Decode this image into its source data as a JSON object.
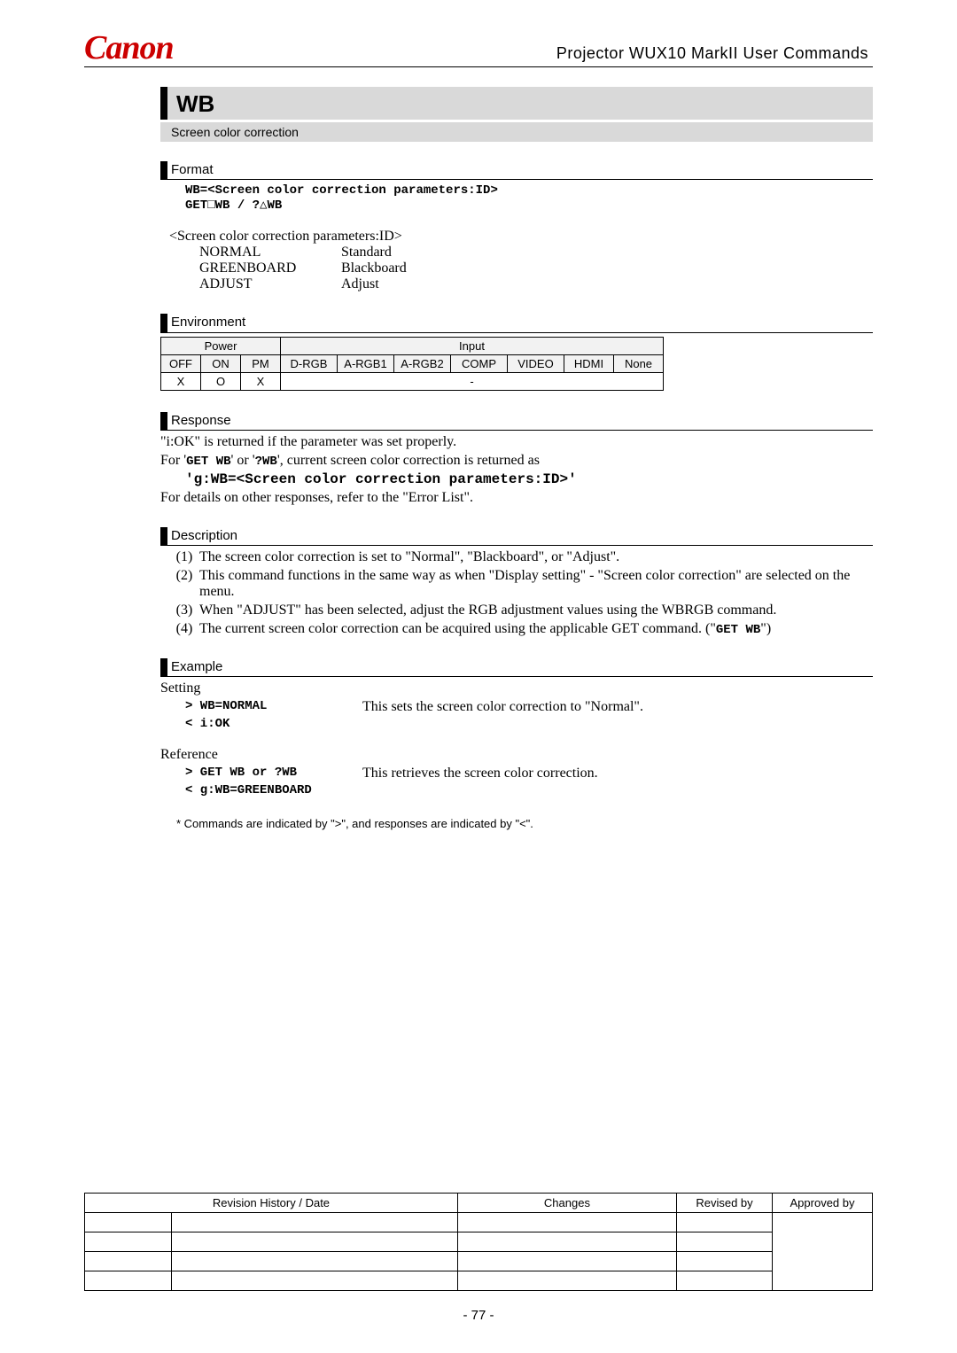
{
  "header": {
    "logo": "Canon",
    "doc_title": "Projector WUX10 MarkII User Commands"
  },
  "command": {
    "name": "WB",
    "subtitle": "Screen color correction"
  },
  "format": {
    "heading": "Format",
    "line1": "WB=<Screen color correction parameters:ID>",
    "line2_pre": "GET",
    "line2_mid": "WB   /   ?",
    "line2_post": "WB",
    "param_heading": "<Screen color correction parameters:ID>",
    "params": [
      {
        "id": "NORMAL",
        "desc": "Standard"
      },
      {
        "id": "GREENBOARD",
        "desc": "Blackboard"
      },
      {
        "id": "ADJUST",
        "desc": "Adjust"
      }
    ]
  },
  "environment": {
    "heading": "Environment",
    "power_label": "Power",
    "input_label": "Input",
    "power_cols": [
      "OFF",
      "ON",
      "PM"
    ],
    "input_cols": [
      "D-RGB",
      "A-RGB1",
      "A-RGB2",
      "COMP",
      "VIDEO",
      "HDMI",
      "None"
    ],
    "power_vals": [
      "X",
      "O",
      "X"
    ],
    "input_val": "-"
  },
  "response": {
    "heading": "Response",
    "line1": "\"i:OK\" is returned if the parameter was set properly.",
    "line2_pre": "For '",
    "line2_cmd1": "GET WB",
    "line2_mid": "' or '",
    "line2_cmd2": "?WB",
    "line2_post": "', current screen color correction is returned as",
    "line3": "'g:WB=<Screen color correction parameters:ID>'",
    "line4": "For details on other responses, refer to the \"Error List\"."
  },
  "description": {
    "heading": "Description",
    "items": [
      {
        "n": "(1)",
        "t": "The screen color correction is set to \"Normal\", \"Blackboard\", or \"Adjust\"."
      },
      {
        "n": "(2)",
        "t": "This command functions in the same way as when \"Display setting\" - \"Screen color correction\" are selected on the menu."
      },
      {
        "n": "(3)",
        "t": "When \"ADJUST\" has been selected, adjust the RGB adjustment values using the WBRGB command."
      }
    ],
    "item4_n": "(4)",
    "item4_pre": "The current screen color correction can be acquired using the applicable GET command. (\"",
    "item4_cmd": "GET WB",
    "item4_post": "\")"
  },
  "example": {
    "heading": "Example",
    "setting_label": "Setting",
    "set_cmd": "> WB=NORMAL",
    "set_desc": "This sets the screen color correction to \"Normal\".",
    "set_resp": "< i:OK",
    "reference_label": "Reference",
    "ref_cmd": "> GET WB or ?WB",
    "ref_desc": "This retrieves the screen color correction.",
    "ref_resp": "< g:WB=GREENBOARD",
    "footnote": "* Commands are indicated by \">\", and responses are indicated by \"<\"."
  },
  "revision": {
    "h1": "Revision History / Date",
    "h2": "Changes",
    "h3": "Revised by",
    "h4": "Approved by"
  },
  "page_number": "- 77 -"
}
